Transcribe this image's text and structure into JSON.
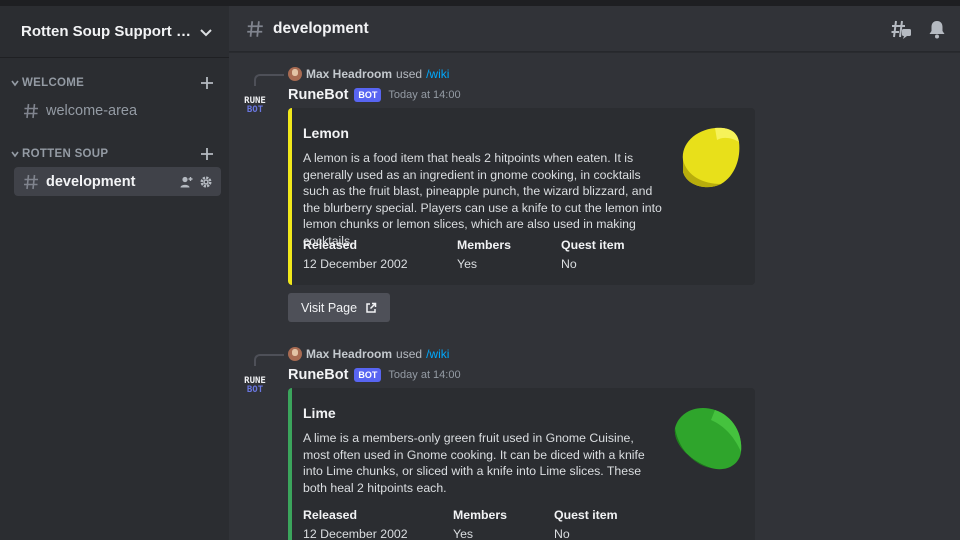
{
  "server": {
    "name": "Rotten Soup Support Se..."
  },
  "sidebar": {
    "categories": [
      {
        "label": "WELCOME",
        "channels": [
          {
            "name": "welcome-area"
          }
        ]
      },
      {
        "label": "ROTTEN SOUP",
        "channels": [
          {
            "name": "development"
          }
        ]
      }
    ]
  },
  "header": {
    "channel": "development"
  },
  "messages": [
    {
      "reply_user": "Max Headroom",
      "reply_used": "used",
      "reply_command": "/wiki",
      "bot_name": "RuneBot",
      "bot_badge": "BOT",
      "timestamp": "Today at 14:00",
      "avatar_line1": "RUNE",
      "avatar_line2": "BOT",
      "embed": {
        "color": "#f1e81b",
        "title": "Lemon",
        "description": "A lemon is a food item that heals 2 hitpoints when eaten. It is generally used as an ingredient in gnome cooking, in cocktails such as the fruit blast, pineapple punch, the wizard blizzard, and the blurberry special. Players can use a knife to cut the lemon into lemon chunks or lemon slices, which are also used in making cocktails.",
        "thumbnail": "lemon-image",
        "fields": [
          {
            "name": "Released",
            "value": "12 December 2002"
          },
          {
            "name": "Members",
            "value": "Yes"
          },
          {
            "name": "Quest item",
            "value": "No"
          }
        ]
      },
      "button_label": "Visit Page"
    },
    {
      "reply_user": "Max Headroom",
      "reply_used": "used",
      "reply_command": "/wiki",
      "bot_name": "RuneBot",
      "bot_badge": "BOT",
      "timestamp": "Today at 14:00",
      "avatar_line1": "RUNE",
      "avatar_line2": "BOT",
      "embed": {
        "color": "#3ba55c",
        "title": "Lime",
        "description": "A lime is a members-only green fruit used in Gnome Cuisine, most often used in Gnome cooking. It can be diced with a knife into Lime chunks, or sliced with a knife into Lime slices. These both heal 2 hitpoints each.",
        "thumbnail": "lime-image",
        "fields": [
          {
            "name": "Released",
            "value": "12 December 2002"
          },
          {
            "name": "Members",
            "value": "Yes"
          },
          {
            "name": "Quest item",
            "value": "No"
          }
        ]
      }
    }
  ]
}
